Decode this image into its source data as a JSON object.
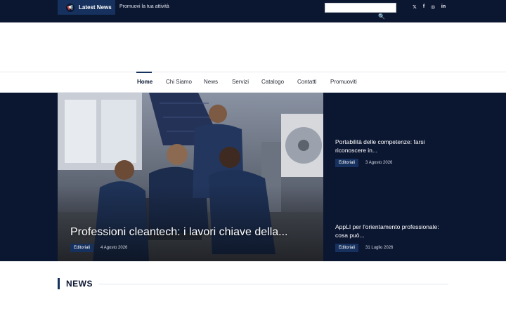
{
  "topbar": {
    "latest_label": "Latest News",
    "latest_icon": "megaphone-icon",
    "promo_link": "Promuovi la tua attività",
    "search_placeholder": "",
    "social": [
      {
        "name": "x-icon",
        "glyph": "𝕏"
      },
      {
        "name": "facebook-icon",
        "glyph": "f"
      },
      {
        "name": "instagram-icon",
        "glyph": "◎"
      },
      {
        "name": "linkedin-icon",
        "glyph": "in"
      }
    ]
  },
  "nav": {
    "items": [
      {
        "label": "Home",
        "active": true
      },
      {
        "label": "Chi Siamo"
      },
      {
        "label": "News"
      },
      {
        "label": "Servizi"
      },
      {
        "label": "Catalogo"
      },
      {
        "label": "Contatti"
      },
      {
        "label": "Promuoviti"
      }
    ]
  },
  "hero": {
    "title": "Professioni cleantech: i lavori chiave della...",
    "category": "Editoriali",
    "date": "4 Agosto 2026"
  },
  "side": [
    {
      "title": "Portabilità delle competenze: farsi riconoscere in...",
      "category": "Editoriali",
      "date": "3 Agosto 2026"
    },
    {
      "title": "AppLI per l'orientamento professionale: cosa può...",
      "category": "Editoriali",
      "date": "31 Luglio 2026"
    }
  ],
  "section": {
    "title": "NEWS"
  },
  "colors": {
    "navy": "#0b1631",
    "accent": "#16315e"
  }
}
